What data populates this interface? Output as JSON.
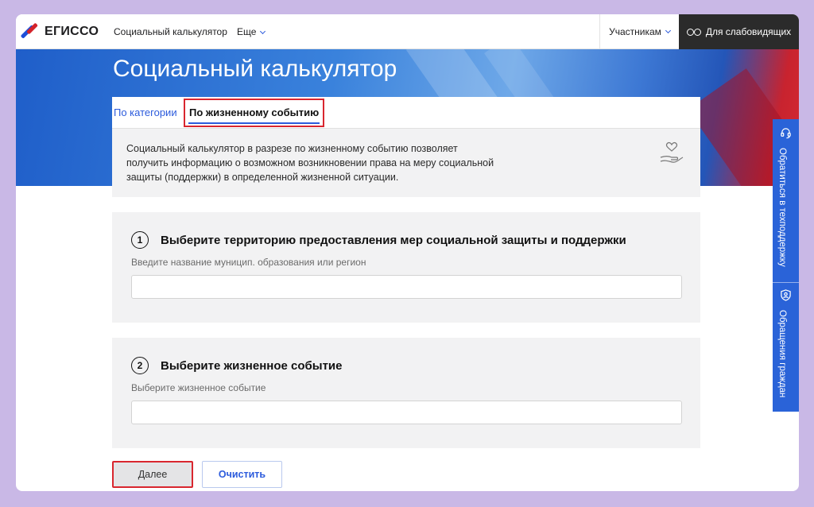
{
  "header": {
    "logo_text": "ЕГИССО",
    "nav": [
      {
        "label": "Социальный калькулятор"
      },
      {
        "label": "Еще"
      }
    ],
    "participants_label": "Участникам",
    "vision_label": "Для слабовидящих"
  },
  "page": {
    "title": "Социальный калькулятор",
    "tabs": [
      {
        "label": "По категории",
        "active": false
      },
      {
        "label": "По жизненному событию",
        "active": true
      }
    ],
    "intro": "Социальный калькулятор в разрезе по жизненному событию позволяет получить информацию о возможном возникновении права на меру социальной защиты (поддержки) в определенной жизненной ситуации."
  },
  "steps": [
    {
      "number": "1",
      "title": "Выберите территорию предоставления мер социальной защиты и поддержки",
      "hint": "Введите название муницип. образования или регион",
      "value": ""
    },
    {
      "number": "2",
      "title": "Выберите жизненное событие",
      "hint": "Выберите жизненное событие",
      "value": ""
    }
  ],
  "buttons": {
    "next_label": "Далее",
    "clear_label": "Очистить"
  },
  "side_panel": {
    "support_label": "Обратиться в техподдержку",
    "appeals_label": "Обращения граждан"
  },
  "colors": {
    "accent": "#2c5bdc",
    "highlight_border": "#d9262f",
    "side_panel": "#2a63d8",
    "vision_bg": "#2b2b2b"
  }
}
